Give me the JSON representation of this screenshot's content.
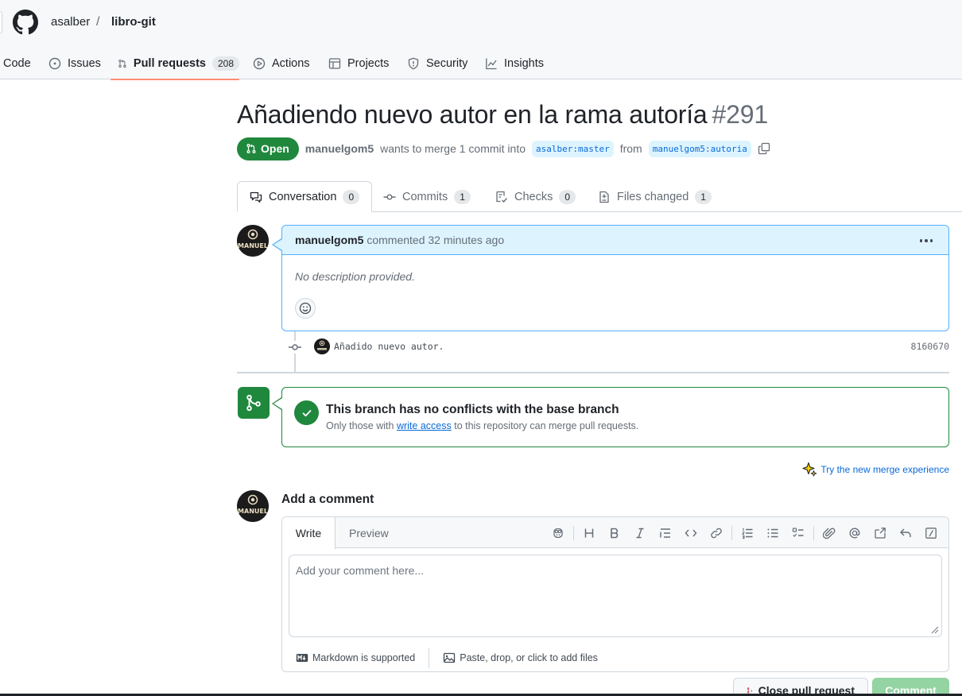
{
  "header": {
    "owner": "asalber",
    "separator": "/",
    "repo": "libro-git"
  },
  "nav": {
    "items": [
      {
        "label": "Code",
        "icon": "code-icon"
      },
      {
        "label": "Issues",
        "icon": "issue-opened-icon"
      },
      {
        "label": "Pull requests",
        "icon": "git-pull-request-icon",
        "count": "208",
        "active": true
      },
      {
        "label": "Actions",
        "icon": "play-icon"
      },
      {
        "label": "Projects",
        "icon": "table-icon"
      },
      {
        "label": "Security",
        "icon": "shield-icon"
      },
      {
        "label": "Insights",
        "icon": "graph-icon"
      }
    ]
  },
  "pr": {
    "title": "Añadiendo nuevo autor en la rama autoría",
    "number": "#291",
    "state": "Open",
    "author": "manuelgom5",
    "merge_text": "wants to merge 1 commit into",
    "base_branch": "asalber:master",
    "from_text": "from",
    "head_branch": "manuelgom5:autoria"
  },
  "tabs": [
    {
      "label": "Conversation",
      "count": "0"
    },
    {
      "label": "Commits",
      "count": "1"
    },
    {
      "label": "Checks",
      "count": "0"
    },
    {
      "label": "Files changed",
      "count": "1"
    }
  ],
  "comment": {
    "author": "manuelgom5",
    "action": "commented 32 minutes ago",
    "body": "No description provided."
  },
  "avatar_text": "MANUEL",
  "commit": {
    "message": "Añadido nuevo autor.",
    "sha": "8160670"
  },
  "merge": {
    "title": "This branch has no conflicts with the base branch",
    "sub_before": "Only those with",
    "sub_link": "write access",
    "sub_after": "to this repository can merge pull requests."
  },
  "try_link": "Try the new merge experience",
  "add_comment": {
    "title": "Add a comment",
    "write_tab": "Write",
    "preview_tab": "Preview",
    "placeholder": "Add your comment here...",
    "markdown_note": "Markdown is supported",
    "attach_note": "Paste, drop, or click to add files"
  },
  "buttons": {
    "close": "Close pull request",
    "comment": "Comment"
  },
  "colors": {
    "accent_green": "#1f883d",
    "link_blue": "#0969da",
    "nav_underline": "#fd8c73"
  }
}
